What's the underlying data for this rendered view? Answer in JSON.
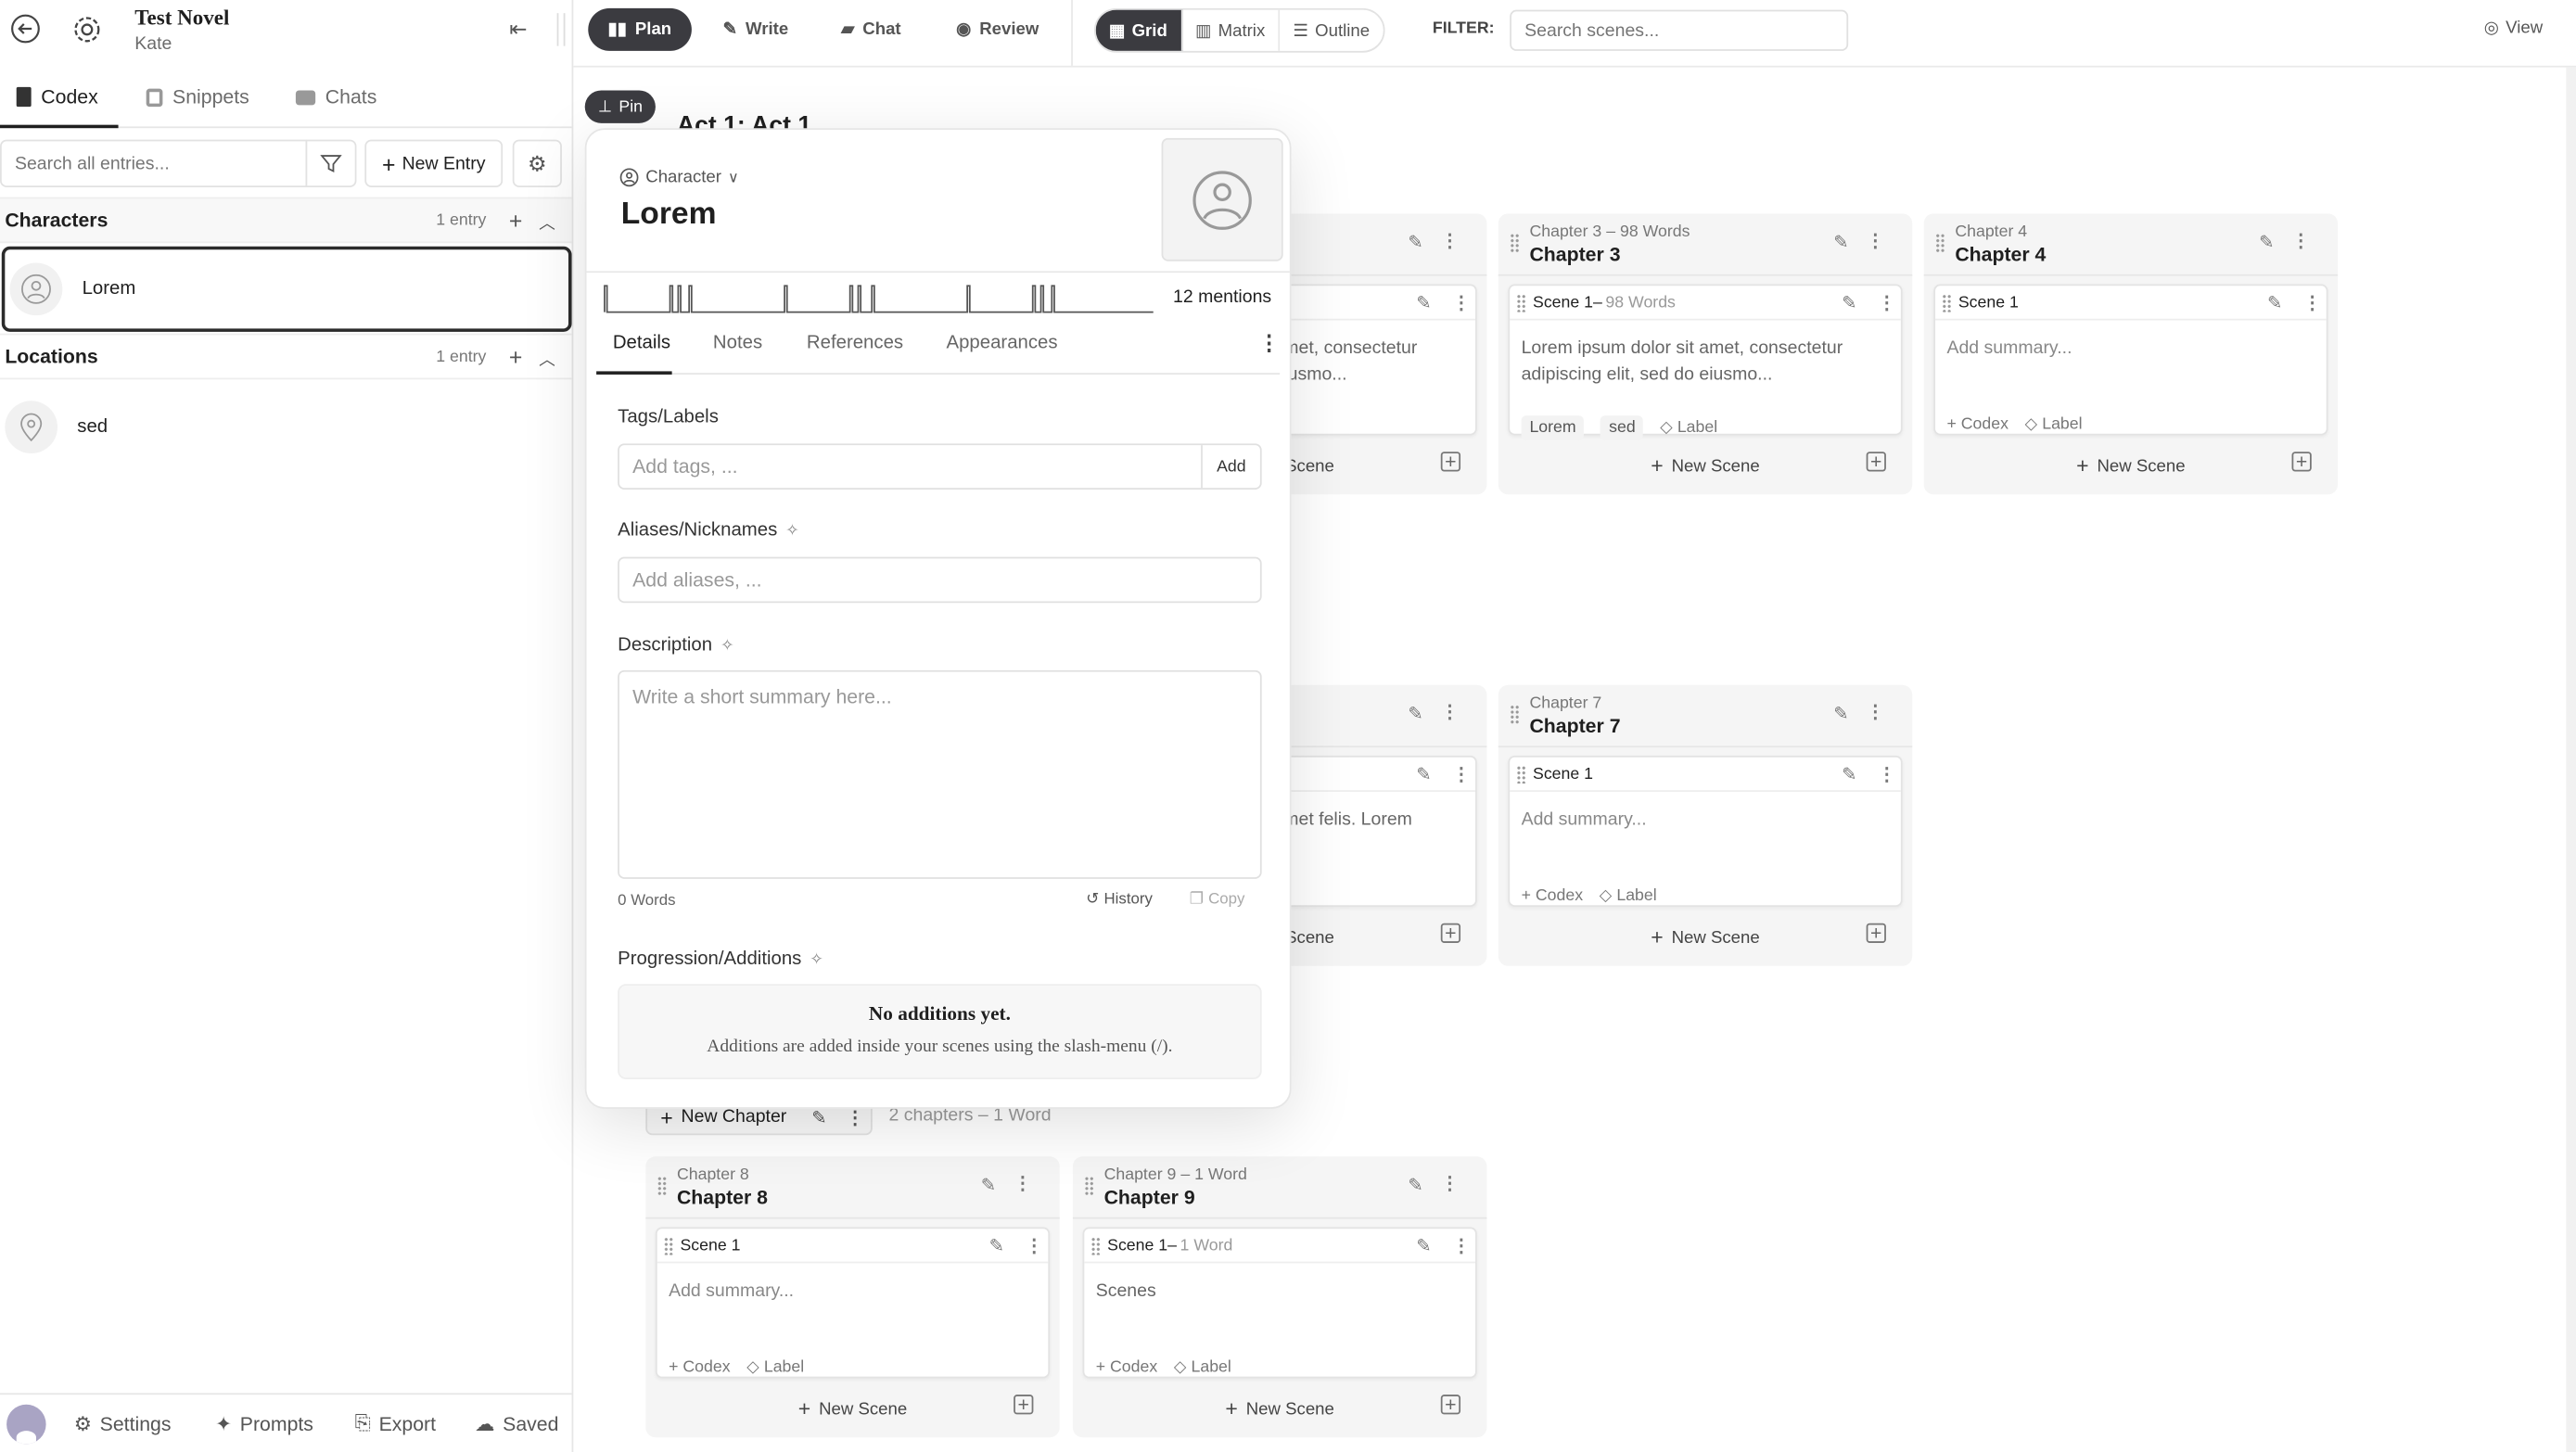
{
  "project": {
    "title": "Test Novel",
    "author": "Kate"
  },
  "sidebar": {
    "tabs": [
      {
        "label": "Codex",
        "icon": "book-icon",
        "active": true
      },
      {
        "label": "Snippets",
        "icon": "copy-icon"
      },
      {
        "label": "Chats",
        "icon": "chat-icon"
      }
    ],
    "search_placeholder": "Search all entries...",
    "new_entry_label": "New Entry",
    "sections": [
      {
        "title": "Characters",
        "count": "1 entry",
        "entries": [
          {
            "name": "Lorem",
            "icon": "user-circle-icon",
            "selected": true
          }
        ]
      },
      {
        "title": "Locations",
        "count": "1 entry",
        "entries": [
          {
            "name": "sed",
            "icon": "map-pin-icon"
          }
        ]
      }
    ],
    "footer": {
      "settings": "Settings",
      "prompts": "Prompts",
      "export": "Export",
      "status": "Saved"
    }
  },
  "topbar": {
    "modes": [
      {
        "label": "Plan",
        "active": true
      },
      {
        "label": "Write"
      },
      {
        "label": "Chat"
      },
      {
        "label": "Review"
      }
    ],
    "views": [
      {
        "label": "Grid",
        "active": true
      },
      {
        "label": "Matrix"
      },
      {
        "label": "Outline"
      }
    ],
    "filter_label": "FILTER:",
    "search_placeholder": "Search scenes...",
    "view_label": "View"
  },
  "board": {
    "pin_label": "Pin",
    "acts": [
      {
        "title": "Act 1: Act 1",
        "chapters": [
          null,
          {
            "caption": "",
            "title": "",
            "scene": {
              "label": "",
              "words": "",
              "summary": "Lorem ipsum dolor sit amet, consectetur adipiscing elit, sed do eiusmo...",
              "tags": []
            },
            "partial": true
          },
          {
            "caption": "Chapter 3",
            "words": "98 Words",
            "title": "Chapter 3",
            "scene": {
              "label": "Scene 1",
              "words": "98 Words",
              "summary": "Lorem ipsum dolor sit amet, consectetur adipiscing elit, sed do eiusmo...",
              "tags": [
                "Lorem",
                "sed"
              ]
            }
          },
          {
            "caption": "Chapter 4",
            "words": "",
            "title": "Chapter 4",
            "scene": {
              "label": "Scene 1",
              "words": "",
              "summary": "Add summary...",
              "tags": []
            }
          }
        ]
      },
      {
        "title": "",
        "chapters": [
          null,
          {
            "caption": "",
            "title": "",
            "scene": {
              "label": "",
              "words": "",
              "summary": "Lorem ipsum dolor sit amet felis. Lorem faucibus et mol...",
              "tags": []
            },
            "partial": true
          },
          {
            "caption": "Chapter 7",
            "words": "",
            "title": "Chapter 7",
            "scene": {
              "label": "Scene 1",
              "words": "",
              "summary": "Add summary...",
              "tags": []
            }
          }
        ]
      },
      {
        "title": "",
        "new_chapter_label": "New Chapter",
        "stats": "2 chapters  –  1 Word",
        "chapters": [
          {
            "caption": "Chapter 8",
            "words": "",
            "title": "Chapter 8",
            "scene": {
              "label": "Scene 1",
              "words": "",
              "summary": "Add summary...",
              "tags": []
            }
          },
          {
            "caption": "Chapter 9",
            "words": "1 Word",
            "title": "Chapter 9",
            "scene": {
              "label": "Scene 1",
              "words": "1 Word",
              "summary": "Scenes",
              "tags": []
            }
          }
        ]
      }
    ],
    "codex_label": "Codex",
    "label_label": "Label",
    "new_scene_label": "New Scene"
  },
  "entry": {
    "type": "Character",
    "name": "Lorem",
    "mentions_label": "12 mentions",
    "mention_positions": [
      0,
      0.12,
      0.135,
      0.155,
      0.33,
      0.45,
      0.465,
      0.49,
      0.665,
      0.785,
      0.8,
      0.82
    ],
    "tabs": [
      {
        "label": "Details",
        "active": true
      },
      {
        "label": "Notes"
      },
      {
        "label": "References"
      },
      {
        "label": "Appearances"
      }
    ],
    "tags_label": "Tags/Labels",
    "tags_placeholder": "Add tags, ...",
    "add_label": "Add",
    "aliases_label": "Aliases/Nicknames",
    "aliases_placeholder": "Add aliases, ...",
    "description_label": "Description",
    "description_placeholder": "Write a short summary here...",
    "word_count": "0 Words",
    "history_label": "History",
    "copy_label": "Copy",
    "progression_label": "Progression/Additions",
    "empty_title": "No additions yet.",
    "empty_text": "Additions are added inside your scenes using the slash-menu (/)."
  },
  "colors": {
    "accent": "#3b3b40",
    "panel": "#f5f5f5"
  }
}
